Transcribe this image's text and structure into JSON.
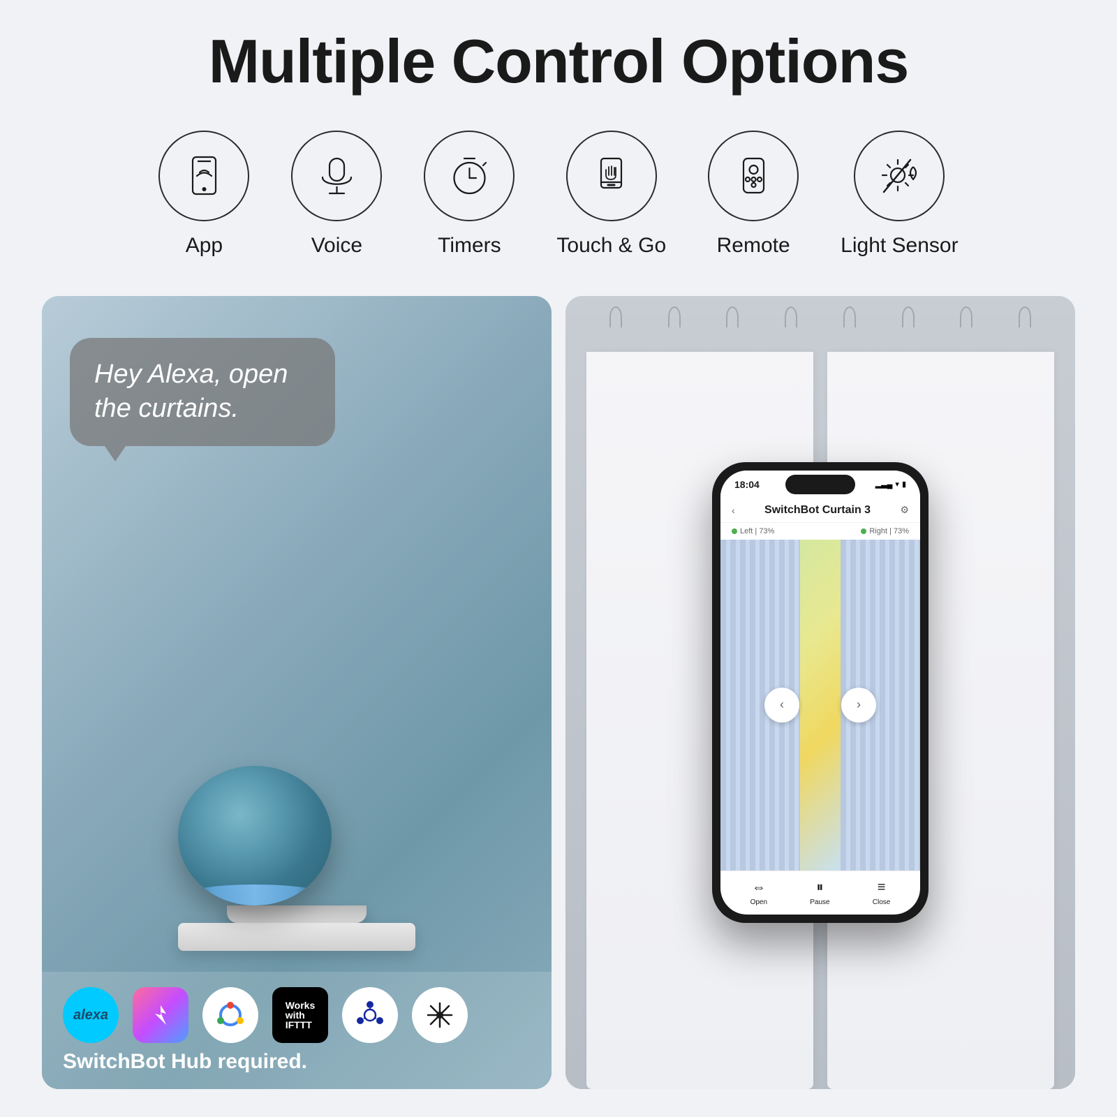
{
  "page": {
    "title": "Multiple Control Options",
    "bg_color": "#f0f2f5"
  },
  "controls": [
    {
      "id": "app",
      "label": "App",
      "icon": "smartphone"
    },
    {
      "id": "voice",
      "label": "Voice",
      "icon": "microphone"
    },
    {
      "id": "timers",
      "label": "Timers",
      "icon": "clock"
    },
    {
      "id": "touch-go",
      "label": "Touch & Go",
      "icon": "hand"
    },
    {
      "id": "remote",
      "label": "Remote",
      "icon": "remote"
    },
    {
      "id": "light-sensor",
      "label": "Light Sensor",
      "icon": "light-sensor"
    }
  ],
  "left_panel": {
    "alexa_quote": "Hey Alexa, open the curtains.",
    "hub_required_text": "SwitchBot Hub required.",
    "logos": [
      "alexa",
      "shortcuts",
      "google",
      "ifttt",
      "smartthings",
      "matter"
    ]
  },
  "right_panel": {
    "phone_time": "18:04",
    "app_title": "SwitchBot Curtain 3",
    "status_left": "Left | 73%",
    "status_right": "Right | 73%",
    "controls": [
      "Open",
      "Pause",
      "Close"
    ]
  }
}
